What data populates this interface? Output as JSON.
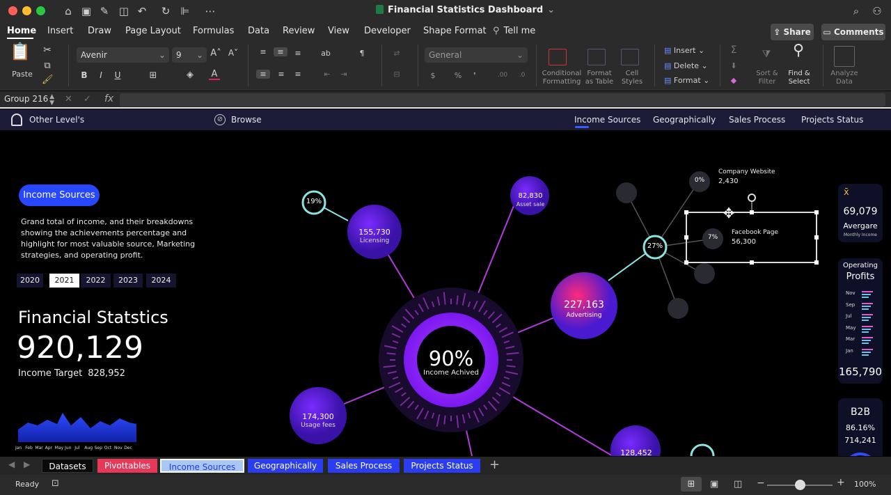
{
  "window": {
    "title": "Financial Statistics Dashboard",
    "share_label": "Share",
    "comments_label": "Comments"
  },
  "menu_tabs": [
    "Home",
    "Insert",
    "Draw",
    "Page Layout",
    "Formulas",
    "Data",
    "Review",
    "View",
    "Developer",
    "Shape Format",
    "Tell me"
  ],
  "ribbon": {
    "paste_label": "Paste",
    "font_name": "Avenir",
    "font_size": "9",
    "number_format": "General",
    "insert_label": "Insert",
    "delete_label": "Delete",
    "format_label": "Format",
    "conditional_formatting": [
      "Conditional",
      "Formatting"
    ],
    "format_as_table": [
      "Format",
      "as Table"
    ],
    "cell_styles": [
      "Cell",
      "Styles"
    ],
    "sort_filter": [
      "Sort &",
      "Filter"
    ],
    "find_select": [
      "Find &",
      "Select"
    ],
    "analyze_data": [
      "Analyze",
      "Data"
    ]
  },
  "formula_bar": {
    "name_box": "Group 216",
    "fx": "fx",
    "value": ""
  },
  "dashboard": {
    "brand": "Other Level's",
    "browse": "Browse",
    "nav": [
      "Income Sources",
      "Geographically",
      "Sales Process",
      "Projects Status"
    ],
    "active_nav": "Income Sources",
    "pill": "Income Sources",
    "description": [
      "Grand total of income, and their breakdowns",
      "showing the achievements percentage and",
      "highlight for most valuable source, Marketing",
      "strategies, and operating profit."
    ],
    "years": [
      "2020",
      "2021",
      "2022",
      "2023",
      "2024"
    ],
    "selected_year": "2021",
    "stats_title": "Financial Statstics",
    "total": "920,129",
    "target_label": "Income Target",
    "target_value": "828,952",
    "months": [
      "Jan",
      "Feb",
      "Mar",
      "Apr",
      "May",
      "Jun",
      "Jul",
      "Aug",
      "Sep",
      "Oct",
      "Nov",
      "Dec"
    ],
    "center_pct": "90%",
    "center_label": "Income Achived",
    "nodes": {
      "licensing": {
        "value": "155,730",
        "label": "Licensing"
      },
      "asset_sale": {
        "value": "82,830",
        "label": "Asset sale"
      },
      "advertising": {
        "value": "227,163",
        "label": "Advertising"
      },
      "usage_fees": {
        "value": "174,300",
        "label": "Usage fees"
      },
      "bottom": {
        "value": "128,452"
      }
    },
    "ring_19": "19%",
    "ring_27": "27%",
    "website_pct": "0%",
    "website_label": "Company Website",
    "website_value": "2,430",
    "facebook_pct": "7%",
    "facebook_label": "Facebook Page",
    "facebook_value": "56,300",
    "avg": {
      "symbol": "x̄",
      "value": "69,079",
      "label": "Avergare",
      "sub": "Monthly Income"
    },
    "profits": {
      "title1": "Operating",
      "title2": "Profits",
      "months": [
        "Nov",
        "Sep",
        "Jul",
        "May",
        "Mar",
        "Jan"
      ],
      "total": "165,790"
    },
    "b2b": {
      "title": "B2B",
      "pct": "86.16%",
      "value": "714,241"
    }
  },
  "sheet_tabs": [
    {
      "label": "Datasets",
      "color": "#0a0a0a"
    },
    {
      "label": "Pivottables",
      "color": "#e8385a"
    },
    {
      "label": "Income Sources",
      "color": "#a8c7f5"
    },
    {
      "label": "Geographically",
      "color": "#2b3df0"
    },
    {
      "label": "Sales Process",
      "color": "#2b3df0"
    },
    {
      "label": "Projects Status",
      "color": "#2b3df0"
    }
  ],
  "status": {
    "ready": "Ready",
    "zoom": "100%"
  }
}
